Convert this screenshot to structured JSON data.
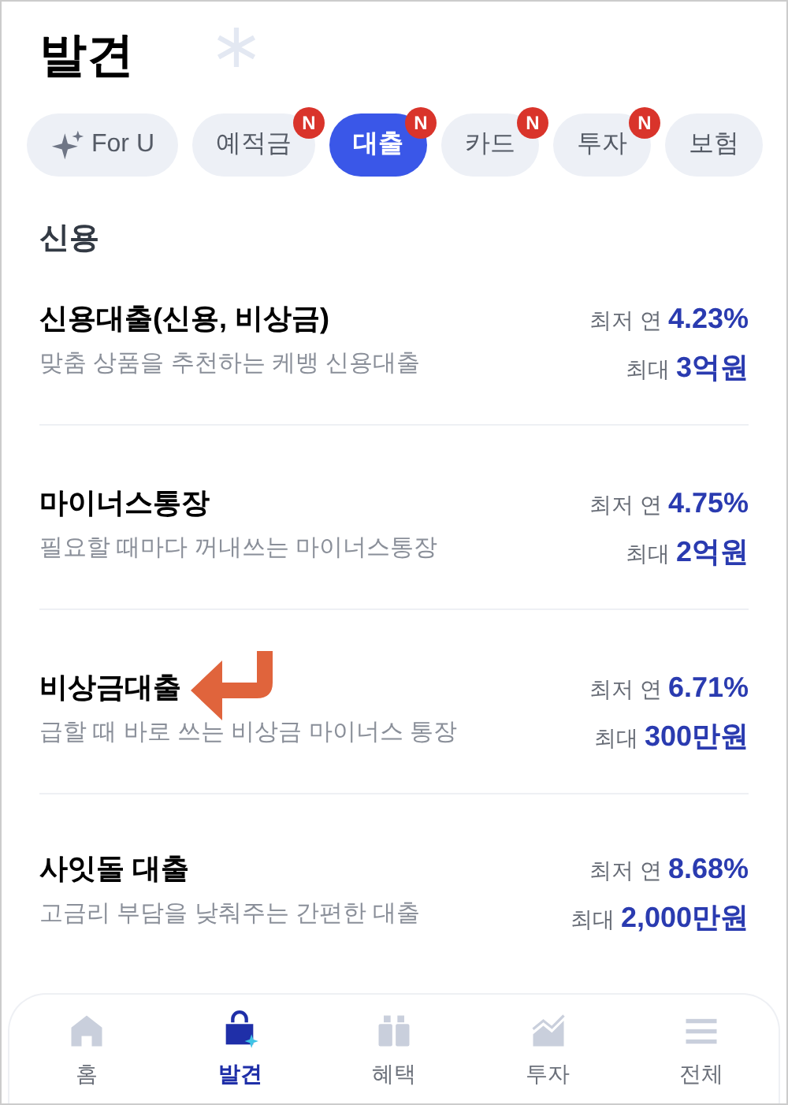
{
  "title": "발견",
  "chips": [
    {
      "label": "For U",
      "kind": "sparkle",
      "selected": false
    },
    {
      "label": "예적금",
      "kind": "plain",
      "selected": false,
      "badge": "N"
    },
    {
      "label": "대출",
      "kind": "plain",
      "selected": true,
      "badge": "N"
    },
    {
      "label": "카드",
      "kind": "plain",
      "selected": false,
      "badge": "N"
    },
    {
      "label": "투자",
      "kind": "plain",
      "selected": false,
      "badge": "N"
    },
    {
      "label": "보험",
      "kind": "plain",
      "selected": false
    }
  ],
  "section": "신용",
  "products": [
    {
      "name": "신용대출(신용, 비상금)",
      "description": "맞춤 상품을 추천하는 케뱅 신용대출",
      "rate_label": "최저 연",
      "rate": "4.23%",
      "limit_label": "최대",
      "limit": "3억원",
      "pointed": false
    },
    {
      "name": "마이너스통장",
      "description": "필요할 때마다 꺼내쓰는 마이너스통장",
      "rate_label": "최저 연",
      "rate": "4.75%",
      "limit_label": "최대",
      "limit": "2억원",
      "pointed": false
    },
    {
      "name": "비상금대출",
      "description": "급할 때 바로 쓰는 비상금 마이너스 통장",
      "rate_label": "최저 연",
      "rate": "6.71%",
      "limit_label": "최대",
      "limit": "300만원",
      "pointed": true
    },
    {
      "name": "사잇돌 대출",
      "description": "고금리 부담을 낮춰주는 간편한 대출",
      "rate_label": "최저 연",
      "rate": "8.68%",
      "limit_label": "최대",
      "limit": "2,000만원",
      "pointed": false
    }
  ],
  "nav": [
    {
      "label": "홈",
      "kind": "home",
      "selected": false
    },
    {
      "label": "발견",
      "kind": "bag",
      "selected": true
    },
    {
      "label": "혜택",
      "kind": "gift",
      "selected": false
    },
    {
      "label": "투자",
      "kind": "chart",
      "selected": false
    },
    {
      "label": "전체",
      "kind": "menu",
      "selected": false
    }
  ]
}
